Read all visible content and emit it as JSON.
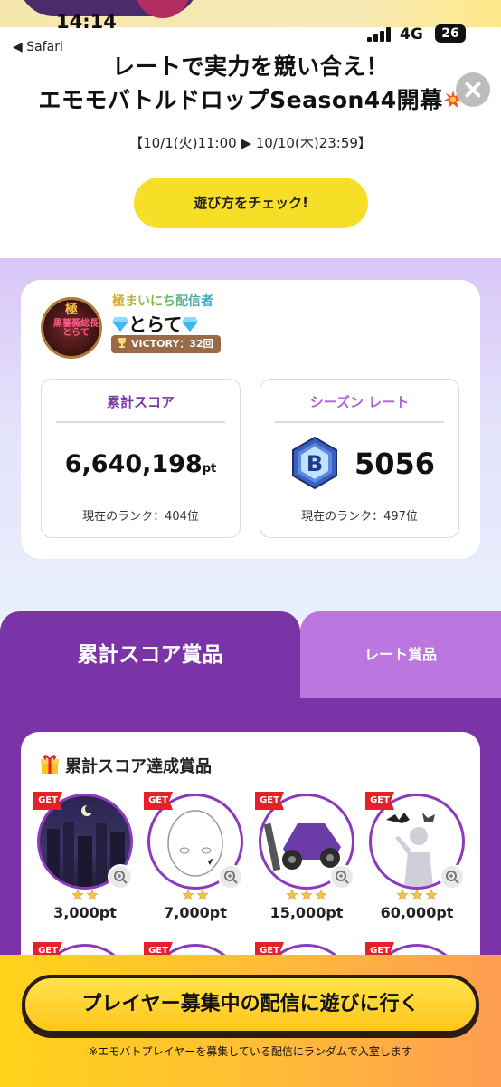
{
  "status_bar": {
    "time": "14:14",
    "back_app": "◀ Safari",
    "network": "4G",
    "battery": "26"
  },
  "header": {
    "title_line1": "レートで実力を競い合え！",
    "title_line2": "エモモバトルドロップSeason44開幕",
    "period": "【10/1(火)11:00 ▶ 10/10(木)23:59】",
    "how_to_button": "遊び方をチェック!"
  },
  "profile": {
    "streamer_rank": "極まいにち配信者",
    "name": "とらて",
    "victory": "VICTORY：32回",
    "avatar_text": "黒薔薇総長とらて",
    "avatar_kanji": "極"
  },
  "stats": {
    "total_score": {
      "label": "累計スコア",
      "value": "6,640,198",
      "unit": "pt",
      "rank": "現在のランク：404位"
    },
    "season_rate": {
      "label": "シーズン レート",
      "badge_letter": "B",
      "value": "5056",
      "rank": "現在のランク：497位"
    }
  },
  "tabs": [
    {
      "label": "累計スコア賞品",
      "active": true
    },
    {
      "label": "レート賞品",
      "active": false
    }
  ],
  "prizes": {
    "heading": "累計スコア達成賞品",
    "get_label": "GET",
    "items": [
      {
        "points": "3,000pt",
        "stars": 2,
        "art": "night-city"
      },
      {
        "points": "7,000pt",
        "stars": 2,
        "art": "face"
      },
      {
        "points": "15,000pt",
        "stars": 3,
        "art": "purple-kart"
      },
      {
        "points": "60,000pt",
        "stars": 3,
        "art": "bat-silhouette"
      }
    ]
  },
  "banner": {
    "play_button": "プレイヤー募集中の配信に遊びに行く",
    "note": "※エモバトプレイヤーを募集している配信にランダムで入室します"
  },
  "colors": {
    "accent_purple": "#7b34a8",
    "tab_inactive": "#bb76df",
    "how_button": "#f7df28",
    "get_red": "#e5202b"
  }
}
